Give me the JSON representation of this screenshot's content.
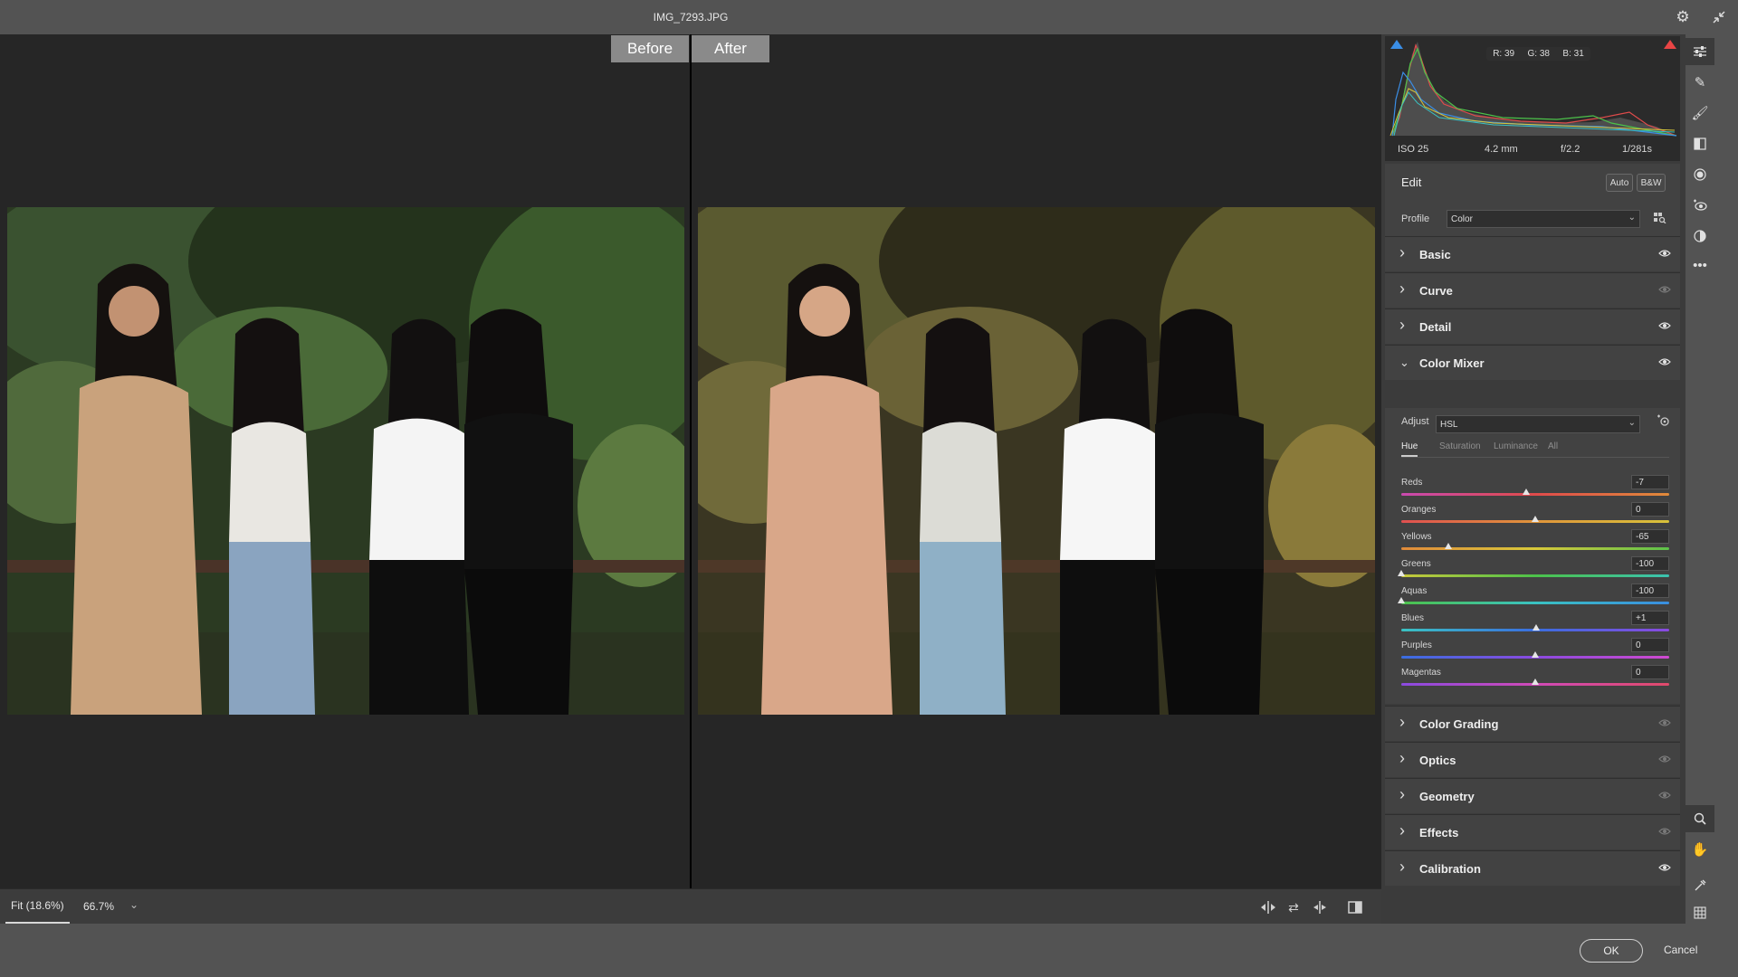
{
  "window": {
    "title": "IMG_7293.JPG"
  },
  "compare": {
    "before_label": "Before",
    "after_label": "After"
  },
  "zoom": {
    "fit_label": "Fit (18.6%)",
    "zoom_value": "66.7%"
  },
  "footer": {
    "ok_label": "OK",
    "cancel_label": "Cancel"
  },
  "histogram": {
    "r": "R: 39",
    "g": "G: 38",
    "b": "B: 31"
  },
  "exif": {
    "iso": "ISO 25",
    "focal": "4.2 mm",
    "aperture": "f/2.2",
    "shutter": "1/281s"
  },
  "edit": {
    "title": "Edit",
    "auto_label": "Auto",
    "bw_label": "B&W",
    "profile_label": "Profile",
    "profile_value": "Color"
  },
  "sections": [
    {
      "label": "Basic",
      "visible": true
    },
    {
      "label": "Curve",
      "visible": false
    },
    {
      "label": "Detail",
      "visible": true
    },
    {
      "label": "Color Mixer",
      "visible": true,
      "expanded": true
    },
    {
      "label": "Color Grading",
      "visible": false
    },
    {
      "label": "Optics",
      "visible": false
    },
    {
      "label": "Geometry",
      "visible": false
    },
    {
      "label": "Effects",
      "visible": false
    },
    {
      "label": "Calibration",
      "visible": true
    }
  ],
  "color_mixer": {
    "adjust_label": "Adjust",
    "adjust_value": "HSL",
    "tabs": [
      "Hue",
      "Saturation",
      "Luminance",
      "All"
    ],
    "active_tab": "Hue",
    "range": [
      -100,
      100
    ],
    "sliders": [
      {
        "name": "Reds",
        "value": "-7",
        "num": -7,
        "gradient": [
          "#c94ab0",
          "#e04b4b",
          "#e08a3a"
        ]
      },
      {
        "name": "Oranges",
        "value": "0",
        "num": 0,
        "gradient": [
          "#e05050",
          "#e0953a",
          "#d8c23a"
        ]
      },
      {
        "name": "Yellows",
        "value": "-65",
        "num": -65,
        "gradient": [
          "#e08a3a",
          "#d8c83a",
          "#5cc24a"
        ]
      },
      {
        "name": "Greens",
        "value": "-100",
        "num": -100,
        "gradient": [
          "#c8c83a",
          "#4cc24a",
          "#3ac2b0"
        ]
      },
      {
        "name": "Aquas",
        "value": "-100",
        "num": -100,
        "gradient": [
          "#4cc24a",
          "#3ac2c2",
          "#3a8ee0"
        ]
      },
      {
        "name": "Blues",
        "value": "+1",
        "num": 1,
        "gradient": [
          "#3ac2c2",
          "#3a6ee0",
          "#8a4ae0"
        ]
      },
      {
        "name": "Purples",
        "value": "0",
        "num": 0,
        "gradient": [
          "#3a6ee0",
          "#8a4ae0",
          "#d04ad0"
        ]
      },
      {
        "name": "Magentas",
        "value": "0",
        "num": 0,
        "gradient": [
          "#8a4ae0",
          "#d04ab8",
          "#e04a6a"
        ]
      }
    ]
  },
  "icons": {
    "settings": "gear-icon",
    "collapse": "collapse-icon",
    "tools": [
      "edit-sliders-icon",
      "healing-icon",
      "brush-icon",
      "gradient-icon",
      "radial-icon",
      "redeye-icon",
      "presets-icon",
      "more-icon",
      "zoom-icon",
      "hand-icon",
      "color-sampler-icon",
      "grid-overlay-icon"
    ]
  },
  "colors": {
    "accent": "#3a8ee6",
    "clip_shadow": "#3a8ee6",
    "clip_highlight": "#e84545"
  }
}
